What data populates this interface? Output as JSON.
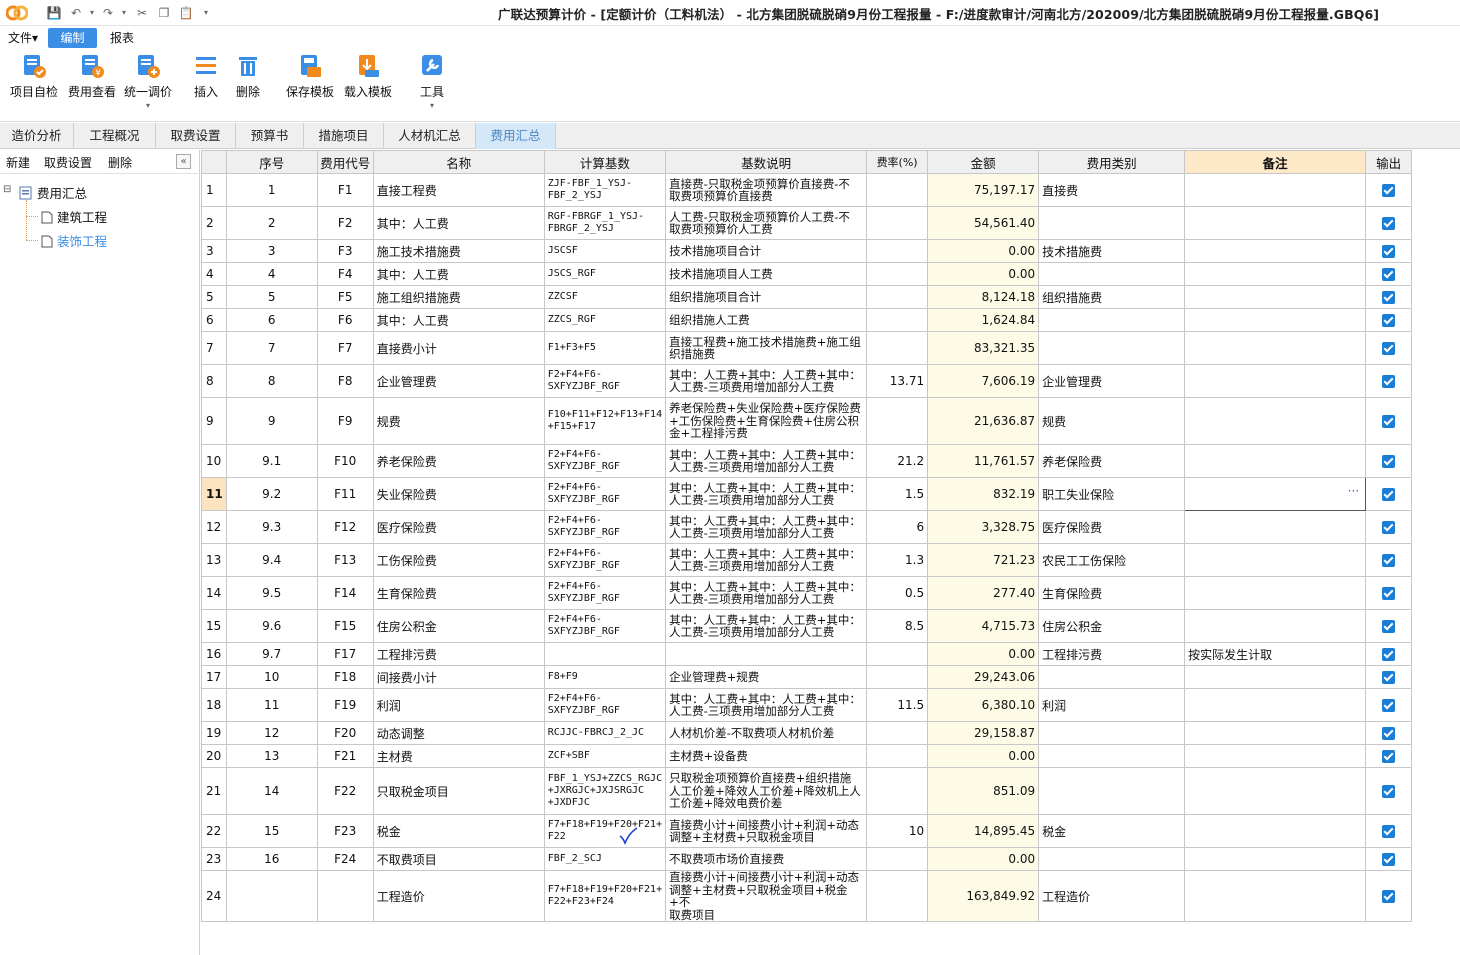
{
  "titlebar": {
    "title": "广联达预算计价 - [定额计价（工料机法） - 北方集团脱硫脱硝9月份工程报量 - F:/进度款审计/河南北方/202009/北方集团脱硫脱硝9月份工程报量.GBQ6]"
  },
  "menu": {
    "file": "文件▾",
    "edit": "编制",
    "report": "报表"
  },
  "ribbon": {
    "self_check": "项目自检",
    "fee_view": "费用查看",
    "unified_price": "统一调价",
    "insert": "插入",
    "delete": "删除",
    "save_template": "保存模板",
    "load_template": "载入模板",
    "tools": "工具"
  },
  "tabs": [
    "造价分析",
    "工程概况",
    "取费设置",
    "预算书",
    "措施项目",
    "人材机汇总",
    "费用汇总"
  ],
  "left_panel": {
    "new": "新建",
    "fee_setting": "取费设置",
    "delete": "删除",
    "root": "费用汇总",
    "children": [
      "建筑工程",
      "装饰工程"
    ]
  },
  "table": {
    "headers": [
      "",
      "序号",
      "费用代号",
      "名称",
      "计算基数",
      "基数说明",
      "费率(%)",
      "金额",
      "费用类别",
      "备注",
      "输出"
    ],
    "rows": [
      {
        "no": "1",
        "seq": "1",
        "code": "F1",
        "name": "直接工程费",
        "base": "ZJF-FBF_1_YSJ-\nFBF_2_YSJ",
        "desc": "直接费-只取税金项预算价直接费-不\n取费项预算价直接费",
        "rate": "",
        "amount": "75,197.17",
        "category": "直接费",
        "remark": ""
      },
      {
        "no": "2",
        "seq": "2",
        "code": "F2",
        "name": "其中：人工费",
        "base": "RGF-FBRGF_1_YSJ-\nFBRGF_2_YSJ",
        "desc": "人工费-只取税金项预算价人工费-不\n取费项预算价人工费",
        "rate": "",
        "amount": "54,561.40",
        "category": "",
        "remark": ""
      },
      {
        "no": "3",
        "seq": "3",
        "code": "F3",
        "name": "施工技术措施费",
        "base": "JSCSF",
        "desc": "技术措施项目合计",
        "rate": "",
        "amount": "0.00",
        "category": "技术措施费",
        "remark": ""
      },
      {
        "no": "4",
        "seq": "4",
        "code": "F4",
        "name": "其中：人工费",
        "base": "JSCS_RGF",
        "desc": "技术措施项目人工费",
        "rate": "",
        "amount": "0.00",
        "category": "",
        "remark": ""
      },
      {
        "no": "5",
        "seq": "5",
        "code": "F5",
        "name": "施工组织措施费",
        "base": "ZZCSF",
        "desc": "组织措施项目合计",
        "rate": "",
        "amount": "8,124.18",
        "category": "组织措施费",
        "remark": ""
      },
      {
        "no": "6",
        "seq": "6",
        "code": "F6",
        "name": "其中：人工费",
        "base": "ZZCS_RGF",
        "desc": "组织措施人工费",
        "rate": "",
        "amount": "1,624.84",
        "category": "",
        "remark": ""
      },
      {
        "no": "7",
        "seq": "7",
        "code": "F7",
        "name": "直接费小计",
        "base": "F1+F3+F5",
        "desc": "直接工程费+施工技术措施费+施工组\n织措施费",
        "rate": "",
        "amount": "83,321.35",
        "category": "",
        "remark": ""
      },
      {
        "no": "8",
        "seq": "8",
        "code": "F8",
        "name": "企业管理费",
        "base": "F2+F4+F6-\nSXFYZJBF_RGF",
        "desc": "其中：人工费+其中：人工费+其中：\n人工费-三项费用增加部分人工费",
        "rate": "13.71",
        "amount": "7,606.19",
        "category": "企业管理费",
        "remark": ""
      },
      {
        "no": "9",
        "seq": "9",
        "code": "F9",
        "name": "规费",
        "base": "F10+F11+F12+F13+F14\n+F15+F17",
        "desc": "养老保险费+失业保险费+医疗保险费\n+工伤保险费+生育保险费+住房公积\n金+工程排污费",
        "rate": "",
        "amount": "21,636.87",
        "category": "规费",
        "remark": ""
      },
      {
        "no": "10",
        "seq": "9.1",
        "code": "F10",
        "name": "养老保险费",
        "base": "F2+F4+F6-\nSXFYZJBF_RGF",
        "desc": "其中：人工费+其中：人工费+其中：\n人工费-三项费用增加部分人工费",
        "rate": "21.2",
        "amount": "11,761.57",
        "category": "养老保险费",
        "remark": ""
      },
      {
        "no": "11",
        "seq": "9.2",
        "code": "F11",
        "name": "失业保险费",
        "base": "F2+F4+F6-\nSXFYZJBF_RGF",
        "desc": "其中：人工费+其中：人工费+其中：\n人工费-三项费用增加部分人工费",
        "rate": "1.5",
        "amount": "832.19",
        "category": "职工失业保险",
        "remark": ""
      },
      {
        "no": "12",
        "seq": "9.3",
        "code": "F12",
        "name": "医疗保险费",
        "base": "F2+F4+F6-\nSXFYZJBF_RGF",
        "desc": "其中：人工费+其中：人工费+其中：\n人工费-三项费用增加部分人工费",
        "rate": "6",
        "amount": "3,328.75",
        "category": "医疗保险费",
        "remark": ""
      },
      {
        "no": "13",
        "seq": "9.4",
        "code": "F13",
        "name": "工伤保险费",
        "base": "F2+F4+F6-\nSXFYZJBF_RGF",
        "desc": "其中：人工费+其中：人工费+其中：\n人工费-三项费用增加部分人工费",
        "rate": "1.3",
        "amount": "721.23",
        "category": "农民工工伤保险",
        "remark": ""
      },
      {
        "no": "14",
        "seq": "9.5",
        "code": "F14",
        "name": "生育保险费",
        "base": "F2+F4+F6-\nSXFYZJBF_RGF",
        "desc": "其中：人工费+其中：人工费+其中：\n人工费-三项费用增加部分人工费",
        "rate": "0.5",
        "amount": "277.40",
        "category": "生育保险费",
        "remark": ""
      },
      {
        "no": "15",
        "seq": "9.6",
        "code": "F15",
        "name": "住房公积金",
        "base": "F2+F4+F6-\nSXFYZJBF_RGF",
        "desc": "其中：人工费+其中：人工费+其中：\n人工费-三项费用增加部分人工费",
        "rate": "8.5",
        "amount": "4,715.73",
        "category": "住房公积金",
        "remark": ""
      },
      {
        "no": "16",
        "seq": "9.7",
        "code": "F17",
        "name": "工程排污费",
        "base": "",
        "desc": "",
        "rate": "",
        "amount": "0.00",
        "category": "工程排污费",
        "remark": "按实际发生计取"
      },
      {
        "no": "17",
        "seq": "10",
        "code": "F18",
        "name": "间接费小计",
        "base": "F8+F9",
        "desc": "企业管理费+规费",
        "rate": "",
        "amount": "29,243.06",
        "category": "",
        "remark": ""
      },
      {
        "no": "18",
        "seq": "11",
        "code": "F19",
        "name": "利润",
        "base": "F2+F4+F6-\nSXFYZJBF_RGF",
        "desc": "其中：人工费+其中：人工费+其中：\n人工费-三项费用增加部分人工费",
        "rate": "11.5",
        "amount": "6,380.10",
        "category": "利润",
        "remark": ""
      },
      {
        "no": "19",
        "seq": "12",
        "code": "F20",
        "name": "动态调整",
        "base": "RCJJC-FBRCJ_2_JC",
        "desc": "人材机价差-不取费项人材机价差",
        "rate": "",
        "amount": "29,158.87",
        "category": "",
        "remark": ""
      },
      {
        "no": "20",
        "seq": "13",
        "code": "F21",
        "name": "主材费",
        "base": "ZCF+SBF",
        "desc": "主材费+设备费",
        "rate": "",
        "amount": "0.00",
        "category": "",
        "remark": ""
      },
      {
        "no": "21",
        "seq": "14",
        "code": "F22",
        "name": "只取税金项目",
        "base": "FBF_1_YSJ+ZZCS_RGJC\n+JXRGJC+JXJSRGJC\n+JXDFJC",
        "desc": "只取税金项预算价直接费+组织措施\n人工价差+降效人工价差+降效机上人\n工价差+降效电费价差",
        "rate": "",
        "amount": "851.09",
        "category": "",
        "remark": ""
      },
      {
        "no": "22",
        "seq": "15",
        "code": "F23",
        "name": "税金",
        "base": "F7+F18+F19+F20+F21+\nF22",
        "desc": "直接费小计+间接费小计+利润+动态\n调整+主材费+只取税金项目",
        "rate": "10",
        "amount": "14,895.45",
        "category": "税金",
        "remark": ""
      },
      {
        "no": "23",
        "seq": "16",
        "code": "F24",
        "name": "不取费项目",
        "base": "FBF_2_SCJ",
        "desc": "不取费项市场价直接费",
        "rate": "",
        "amount": "0.00",
        "category": "",
        "remark": ""
      },
      {
        "no": "24",
        "seq": "",
        "code": "",
        "name": "工程造价",
        "base": "F7+F18+F19+F20+F21+\nF22+F23+F24",
        "desc": "直接费小计+间接费小计+利润+动态\n调整+主材费+只取税金项目+税金+不\n取费项目",
        "rate": "",
        "amount": "163,849.92",
        "category": "工程造价",
        "remark": ""
      }
    ]
  },
  "colors": {
    "accent": "#3a8ee6",
    "checkbox": "#1a7fd4",
    "amount_bg": "#fdfbe6",
    "remark_header_bg": "#fde9c8",
    "active_tab_bg": "#d5e8f8"
  }
}
